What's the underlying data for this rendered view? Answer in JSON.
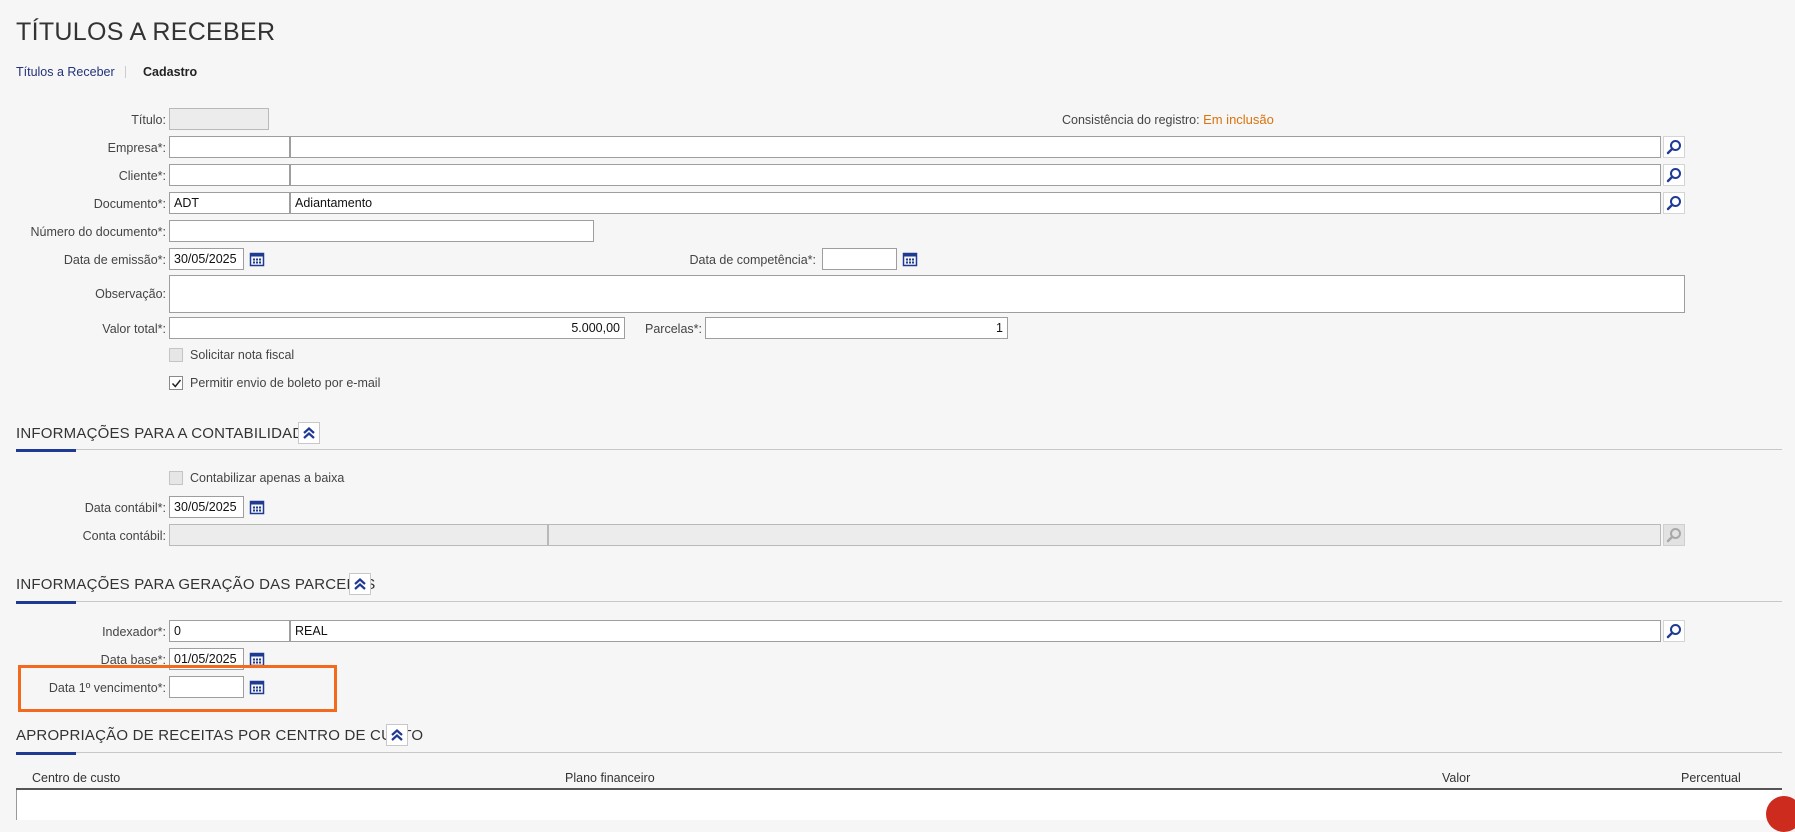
{
  "page": {
    "title": "TÍTULOS A RECEBER"
  },
  "breadcrumb": {
    "item1": "Títulos a Receber",
    "item2": "Cadastro"
  },
  "form": {
    "titulo": {
      "label": "Título:",
      "value": ""
    },
    "consistencia": {
      "label": "Consistência do registro:",
      "status": "Em inclusão"
    },
    "empresa": {
      "label": "Empresa*:",
      "code": "",
      "name": ""
    },
    "cliente": {
      "label": "Cliente*:",
      "code": "",
      "name": ""
    },
    "documento": {
      "label": "Documento*:",
      "code": "ADT",
      "name": "Adiantamento"
    },
    "numero_documento": {
      "label": "Número do documento*:",
      "value": ""
    },
    "data_emissao": {
      "label": "Data de emissão*:",
      "value": "30/05/2025"
    },
    "data_competencia": {
      "label": "Data de competência*:",
      "value": ""
    },
    "observacao": {
      "label": "Observação:",
      "value": ""
    },
    "valor_total": {
      "label": "Valor total*:",
      "value": "5.000,00"
    },
    "parcelas": {
      "label": "Parcelas*:",
      "value": "1"
    },
    "solicitar_nota": {
      "label": "Solicitar nota fiscal",
      "checked": false
    },
    "permitir_boleto": {
      "label": "Permitir envio de boleto por e-mail",
      "checked": true
    }
  },
  "contabilidade": {
    "title": "INFORMAÇÕES PARA A CONTABILIDADE",
    "contabilizar_baixa": {
      "label": "Contabilizar apenas a baixa",
      "checked": false
    },
    "data_contabil": {
      "label": "Data contábil*:",
      "value": "30/05/2025"
    },
    "conta_contabil": {
      "label": "Conta contábil:",
      "code": "",
      "name": ""
    }
  },
  "parcelas_section": {
    "title": "INFORMAÇÕES PARA GERAÇÃO DAS PARCELAS",
    "indexador": {
      "label": "Indexador*:",
      "code": "0",
      "name": "REAL"
    },
    "data_base": {
      "label": "Data base*:",
      "value": "01/05/2025"
    },
    "data_vencimento": {
      "label": "Data 1º vencimento*:",
      "value": ""
    }
  },
  "apropriacao": {
    "title": "APROPRIAÇÃO DE RECEITAS POR CENTRO DE CUSTO",
    "columns": [
      "Centro de custo",
      "Plano financeiro",
      "Valor",
      "Percentual"
    ]
  },
  "colors": {
    "accent": "#1f3a93",
    "status": "#d9730d",
    "highlight": "#f36a1e"
  },
  "icons": {
    "search": "search-icon",
    "calendar": "calendar-icon",
    "collapse": "double-chevron-up-icon",
    "check": "check-icon"
  }
}
